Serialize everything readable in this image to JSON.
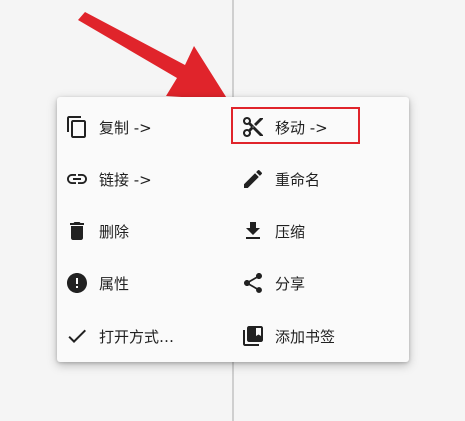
{
  "menu": {
    "left": [
      {
        "label": "复制 ->",
        "icon": "copy-icon"
      },
      {
        "label": "链接 ->",
        "icon": "link-icon"
      },
      {
        "label": "删除",
        "icon": "delete-icon"
      },
      {
        "label": "属性",
        "icon": "info-icon"
      },
      {
        "label": "打开方式…",
        "icon": "check-icon"
      }
    ],
    "right": [
      {
        "label": "移动 ->",
        "icon": "scissors-icon"
      },
      {
        "label": "重命名",
        "icon": "pencil-icon"
      },
      {
        "label": "压缩",
        "icon": "download-icon"
      },
      {
        "label": "分享",
        "icon": "share-icon"
      },
      {
        "label": "添加书签",
        "icon": "bookmark-icon"
      }
    ]
  },
  "colors": {
    "highlight": "#e0242b",
    "arrow": "#e0242b",
    "text": "#212121"
  }
}
